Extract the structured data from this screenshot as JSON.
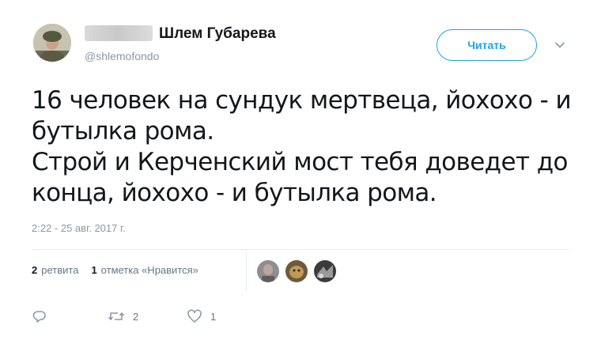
{
  "author": {
    "display_name": "Шлем Губарева",
    "handle": "@shlemofondo",
    "avatar_icon": "soldier-avatar",
    "redacted_prefix_icon": "blurred-name"
  },
  "follow_button": {
    "label": "Читать",
    "accent": "#1da1f2"
  },
  "menu": {
    "icon": "chevron-down-icon"
  },
  "tweet": {
    "lines": [
      "16 человек на сундук мертвеца, йохохо - и",
      "бутылка рома.",
      "Строй и Керченский мост тебя доведет до",
      "конца, йохохо - и бутылка рома."
    ],
    "timestamp": "2:22 - 25 авг. 2017 г."
  },
  "stats": {
    "retweets_count": "2",
    "retweets_label": "ретвита",
    "likes_count": "1",
    "likes_label": "отметка «Нравится»",
    "liker_avatars": [
      "liker-avatar-1",
      "liker-avatar-2",
      "liker-avatar-3"
    ]
  },
  "actions": {
    "reply_icon": "reply-icon",
    "retweet_icon": "retweet-icon",
    "retweet_count": "2",
    "like_icon": "heart-icon",
    "like_count": "1"
  },
  "colors": {
    "text": "#14171a",
    "muted": "#8899a6",
    "divider": "#e6ecf0"
  }
}
